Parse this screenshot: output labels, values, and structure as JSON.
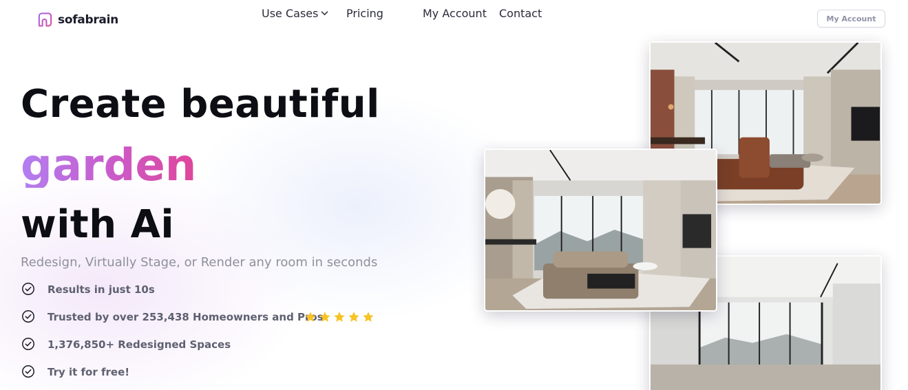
{
  "brand": {
    "name": "sofabrain",
    "logo_icon": "home-outline-icon",
    "logo_colors": [
      "#a06cf0",
      "#e04aa0"
    ]
  },
  "nav": {
    "items": [
      {
        "label": "Use Cases",
        "has_dropdown": true
      },
      {
        "label": "Pricing",
        "has_dropdown": false
      },
      {
        "label": "My Account",
        "has_dropdown": false
      },
      {
        "label": "Contact",
        "has_dropdown": false
      }
    ],
    "account_button": "My Account"
  },
  "hero": {
    "line1": "Create beautiful",
    "highlight": "garden",
    "line3": "with Ai",
    "subtitle": "Redesign, Virtually Stage, or Render any room in seconds",
    "accent_gradient": [
      "#b27ff0",
      "#e0459a"
    ]
  },
  "features": [
    {
      "text": "Results in just 10s",
      "icon": "check-circle-icon"
    },
    {
      "text": "Trusted by over 253,438 Homeowners and Pros",
      "icon": "check-circle-icon",
      "rating_stars": 5
    },
    {
      "text": "1,376,850+ Redesigned Spaces",
      "icon": "check-circle-icon"
    },
    {
      "text": "Try it for free!",
      "icon": "check-circle-icon"
    }
  ],
  "gallery": [
    {
      "name": "living-room-render-top"
    },
    {
      "name": "living-room-render-middle"
    },
    {
      "name": "empty-room-render-bottom"
    }
  ],
  "colors": {
    "star": "#f7c325",
    "text_muted": "#8e909b"
  }
}
